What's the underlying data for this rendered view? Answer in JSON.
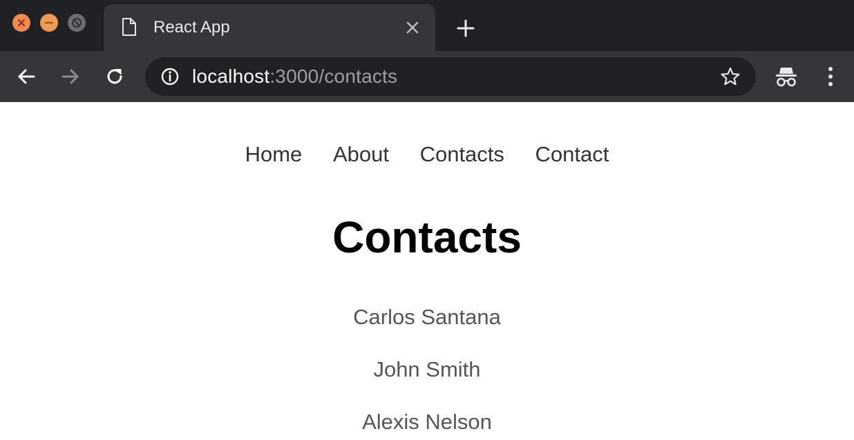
{
  "browser": {
    "tab": {
      "title": "React App",
      "close_icon": "close-icon"
    },
    "new_tab_icon": "plus-icon",
    "address": {
      "host": "localhost",
      "path": ":3000/contacts"
    },
    "toolbar_icons": [
      "back-arrow-icon",
      "forward-arrow-icon",
      "reload-icon",
      "info-icon",
      "star-icon",
      "incognito-icon",
      "kebab-menu-icon"
    ],
    "colors": {
      "tabstrip": "#202124",
      "toolbar": "#35363a",
      "traffic_close": "#ee8a52",
      "traffic_minimize": "#ee9a57",
      "traffic_zoom": "#6b6e70"
    }
  },
  "page": {
    "nav": [
      "Home",
      "About",
      "Contacts",
      "Contact"
    ],
    "title": "Contacts",
    "contacts": [
      "Carlos Santana",
      "John Smith",
      "Alexis Nelson"
    ]
  }
}
